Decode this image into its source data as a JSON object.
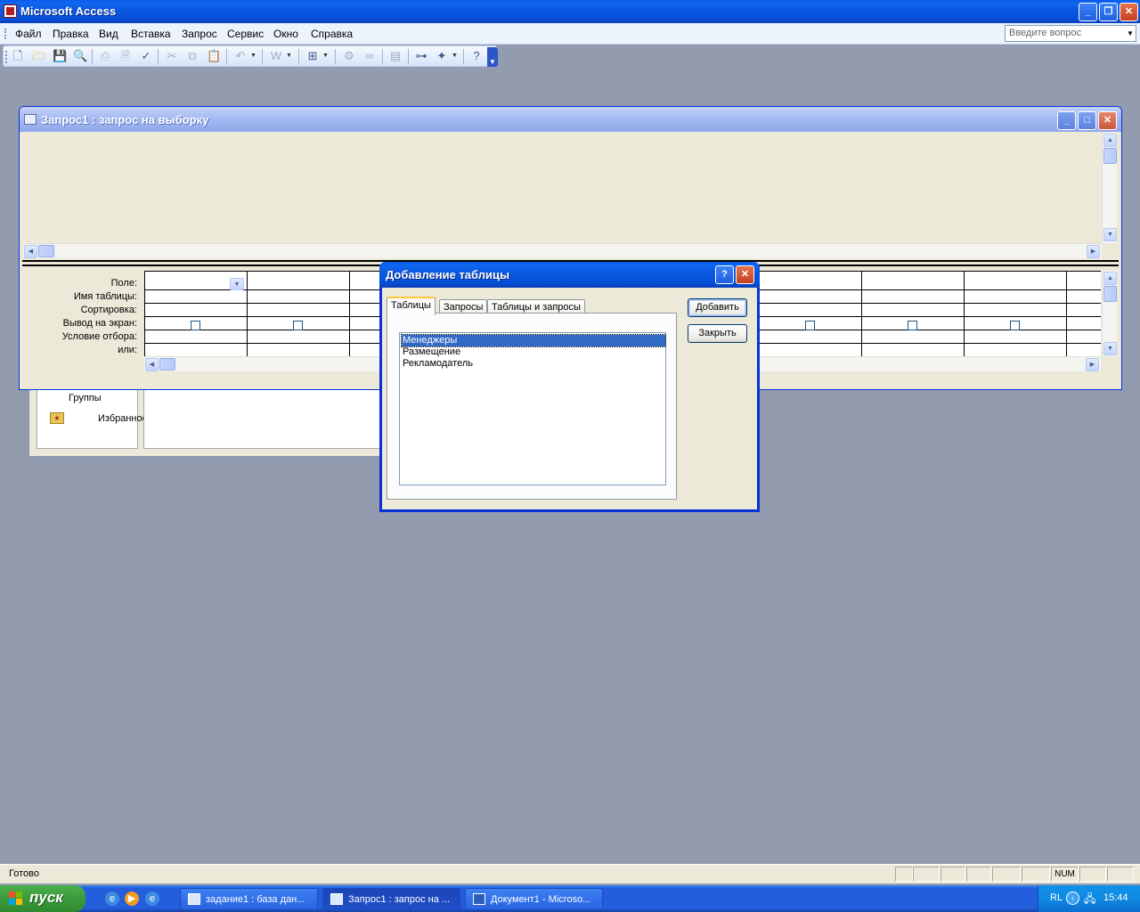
{
  "app": {
    "title": "Microsoft Access"
  },
  "menu": {
    "items": [
      "Файл",
      "Правка",
      "Вид",
      "Вставка",
      "Запрос",
      "Сервис",
      "Окно",
      "Справка"
    ],
    "help_placeholder": "Введите вопрос"
  },
  "database_window": {
    "groups_label": "Группы",
    "favorites_label": "Избранное"
  },
  "query_window": {
    "title": "Запрос1 : запрос на выборку",
    "grid_rows": [
      "Поле:",
      "Имя таблицы:",
      "Сортировка:",
      "Вывод на экран:",
      "Условие отбора:",
      "или:"
    ]
  },
  "dialog": {
    "title": "Добавление таблицы",
    "tabs": [
      "Таблицы",
      "Запросы",
      "Таблицы и запросы"
    ],
    "selected_tab": "Таблицы",
    "tables": [
      "Менеджеры",
      "Размещение",
      "Рекламодатель"
    ],
    "selected_table": "Менеджеры",
    "add_button": "Добавить",
    "close_button": "Закрыть"
  },
  "statusbar": {
    "status": "Готово",
    "num": "NUM"
  },
  "taskbar": {
    "start": "пуск",
    "tasks": [
      {
        "label": "задание1 : база дан...",
        "active": false
      },
      {
        "label": "Запрос1 : запрос на ...",
        "active": true
      },
      {
        "label": "Документ1 - Microso...",
        "active": false
      }
    ],
    "language": "RL",
    "clock": "15:44"
  },
  "colors": {
    "title_blue": "#0A57E0",
    "desktop_gray": "#939BAF",
    "selection": "#316AC5",
    "start_green": "#3C9A3C",
    "close_red": "#C2401F"
  }
}
